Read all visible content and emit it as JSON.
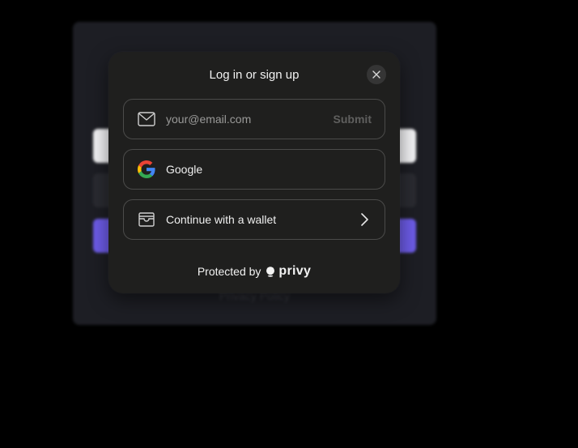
{
  "background": {
    "link_text": "Privacy Policy"
  },
  "modal": {
    "title": "Log in or sign up",
    "close_icon": "close-icon",
    "email": {
      "icon": "mail-icon",
      "placeholder": "your@email.com",
      "value": "",
      "submit_label": "Submit"
    },
    "google": {
      "icon": "google-icon",
      "label": "Google"
    },
    "wallet": {
      "icon": "wallet-icon",
      "label": "Continue with a wallet",
      "chevron_icon": "chevron-right-icon"
    },
    "footer": {
      "prefix": "Protected by",
      "brand": "privy",
      "brand_icon": "privy-logo-icon"
    }
  },
  "colors": {
    "modal_bg": "#1f1f1e",
    "border": "#4b4b4a",
    "accent_bg_button": "#6d5ce8"
  }
}
